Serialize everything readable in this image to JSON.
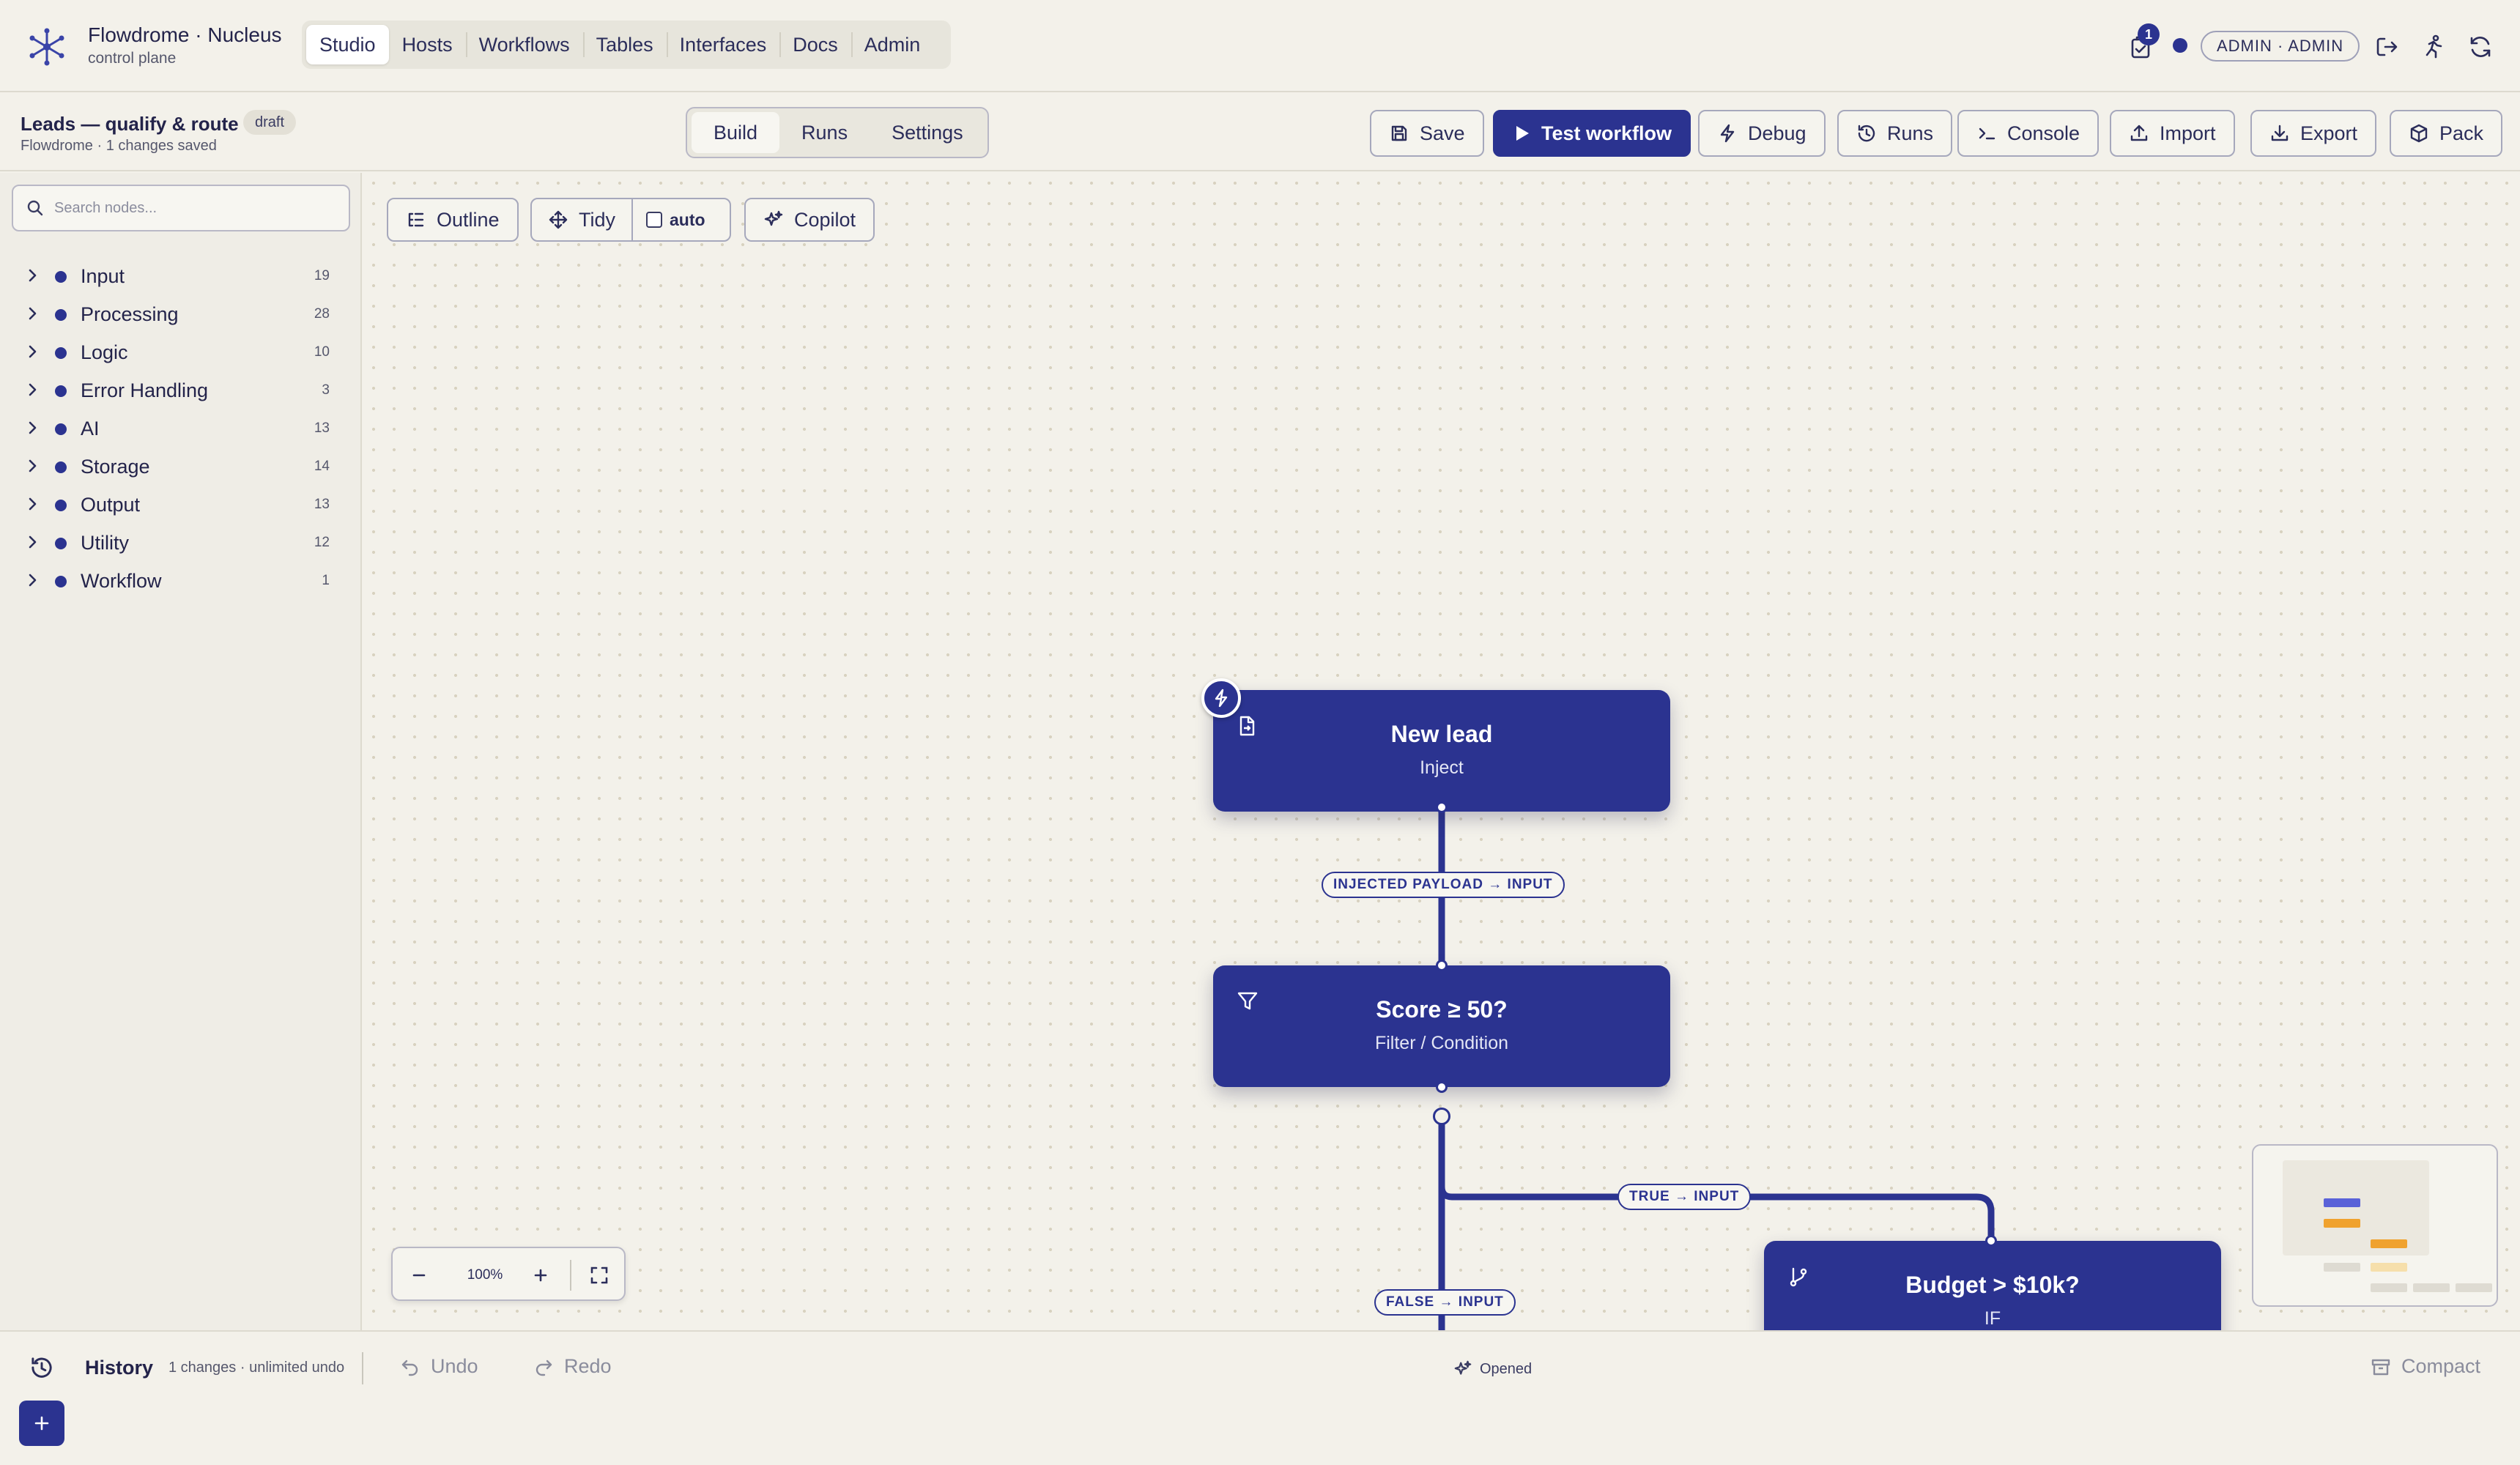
{
  "brand": {
    "title": "Flowdrome · Nucleus",
    "subtitle": "control plane",
    "icon": "network-logo-icon"
  },
  "nav": {
    "tabs": [
      "Studio",
      "Hosts",
      "Workflows",
      "Tables",
      "Interfaces",
      "Docs",
      "Admin"
    ],
    "active": "Studio"
  },
  "header_right": {
    "notification_count": "1",
    "user": "ADMIN · ADMIN"
  },
  "workflow": {
    "title": "Leads — qualify & route",
    "status": "draft",
    "subtitle": "Flowdrome · 1 changes saved"
  },
  "modes": {
    "items": [
      "Build",
      "Runs",
      "Settings"
    ],
    "active": "Build"
  },
  "toolbar": {
    "save": "Save",
    "test": "Test workflow",
    "debug": "Debug",
    "runs": "Runs",
    "console": "Console",
    "import": "Import",
    "export": "Export",
    "pack": "Pack"
  },
  "sidebar": {
    "search_placeholder": "Search nodes...",
    "categories": [
      {
        "label": "Input",
        "count": "19"
      },
      {
        "label": "Processing",
        "count": "28"
      },
      {
        "label": "Logic",
        "count": "10"
      },
      {
        "label": "Error Handling",
        "count": "3"
      },
      {
        "label": "AI",
        "count": "13"
      },
      {
        "label": "Storage",
        "count": "14"
      },
      {
        "label": "Output",
        "count": "13"
      },
      {
        "label": "Utility",
        "count": "12"
      },
      {
        "label": "Workflow",
        "count": "1"
      }
    ]
  },
  "canvas": {
    "toolbar": {
      "outline": "Outline",
      "tidy": "Tidy",
      "auto": "auto",
      "copilot": "Copilot"
    },
    "nodes": [
      {
        "title": "New lead",
        "type": "Inject"
      },
      {
        "title": "Score ≥ 50?",
        "type": "Filter / Condition"
      },
      {
        "title": "Budget > $10k?",
        "type": "IF"
      }
    ],
    "edges": [
      {
        "label": "INJECTED PAYLOAD → INPUT"
      },
      {
        "label": "TRUE → INPUT"
      },
      {
        "label": "FALSE → INPUT"
      }
    ],
    "zoom": "100%"
  },
  "history": {
    "title": "History",
    "meta": "1 changes · unlimited undo",
    "undo": "Undo",
    "redo": "Redo",
    "status": "Opened",
    "compact": "Compact"
  },
  "colors": {
    "accent": "#2b3390",
    "background": "#f3f1ea",
    "minimap_orange": "#f0a22e"
  }
}
